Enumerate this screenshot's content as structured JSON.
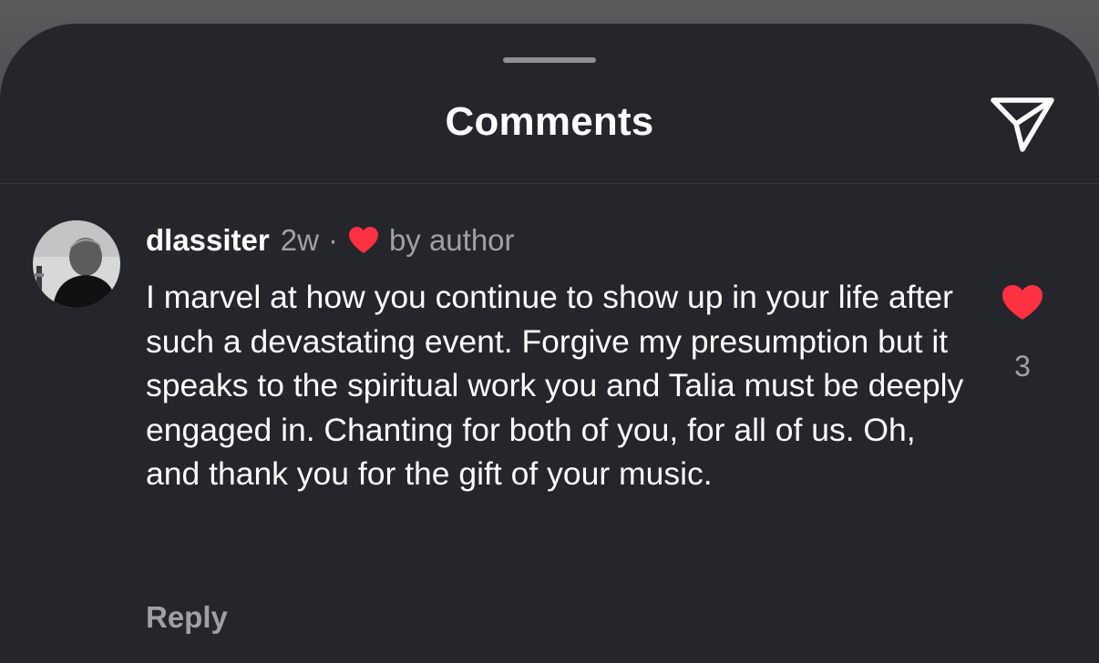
{
  "header": {
    "title": "Comments",
    "share_icon": "send-paper-plane-icon"
  },
  "comment": {
    "username": "dlassiter",
    "time": "2w",
    "separator": "·",
    "liked_by_label": "by author",
    "liked_by_icon": "heart-icon",
    "text": "I marvel at how you continue to show up in your life after such a devastating event. Forgive my presumption but it speaks to the spiritual work you and Talia must be deeply engaged in. Chanting for both of you, for all of us. Oh, and thank you for the gift of your music.",
    "reply_label": "Reply",
    "like_count": "3",
    "liked": true
  },
  "colors": {
    "sheet_background": "#24262b",
    "heart_red": "#ff3040",
    "secondary_text": "#9ea1a7",
    "primary_text": "#ffffff"
  }
}
